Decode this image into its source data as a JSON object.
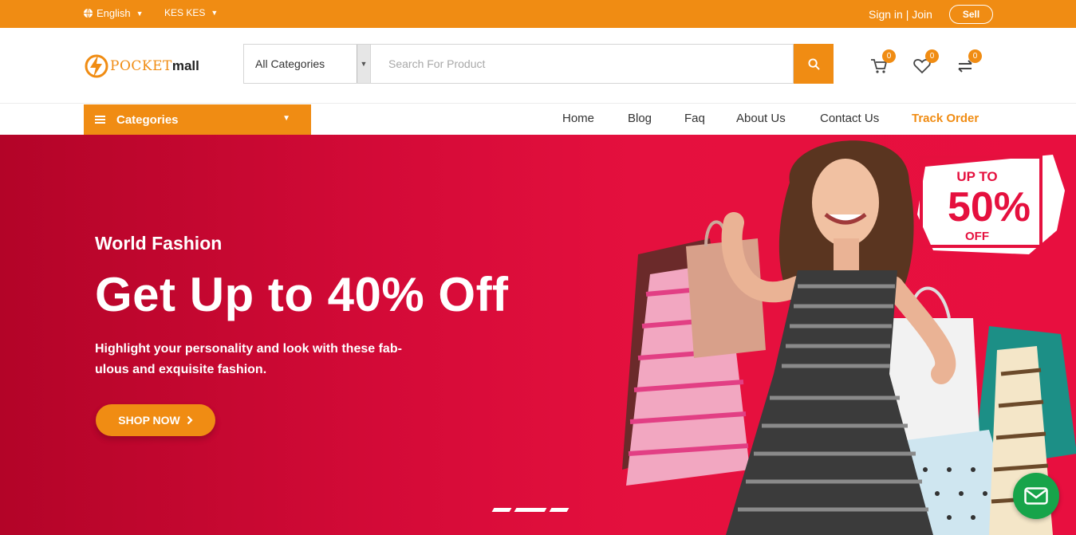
{
  "topbar": {
    "language": "English",
    "currency": "KES KES",
    "signin": "Sign in | Join",
    "sell": "Sell"
  },
  "header": {
    "logo_part1": "POCKET",
    "logo_part2": "mall",
    "category_select": "All Categories",
    "search_placeholder": "Search For Product",
    "cart_count": "0",
    "wishlist_count": "0",
    "compare_count": "0"
  },
  "nav": {
    "categories_label": "Categories",
    "items": [
      "Home",
      "Blog",
      "Faq",
      "About Us",
      "Contact Us",
      "Track Order"
    ]
  },
  "hero": {
    "subtitle": "World Fashion",
    "headline": "Get Up to 40% Off",
    "description": "Highlight your personality and look with these fab-ulous and exquisite fashion.",
    "cta": "SHOP NOW",
    "promo_line1": "UP TO",
    "promo_line2": "50%",
    "promo_line3": "OFF"
  },
  "colors": {
    "accent": "#f08c13",
    "hero_red": "#e5103e",
    "chat_green": "#17a44a"
  },
  "icons": {
    "language": "globe-icon",
    "search": "search-icon",
    "cart": "cart-icon",
    "wishlist": "heart-icon",
    "compare": "compare-arrows-icon",
    "chat": "mail-icon"
  }
}
